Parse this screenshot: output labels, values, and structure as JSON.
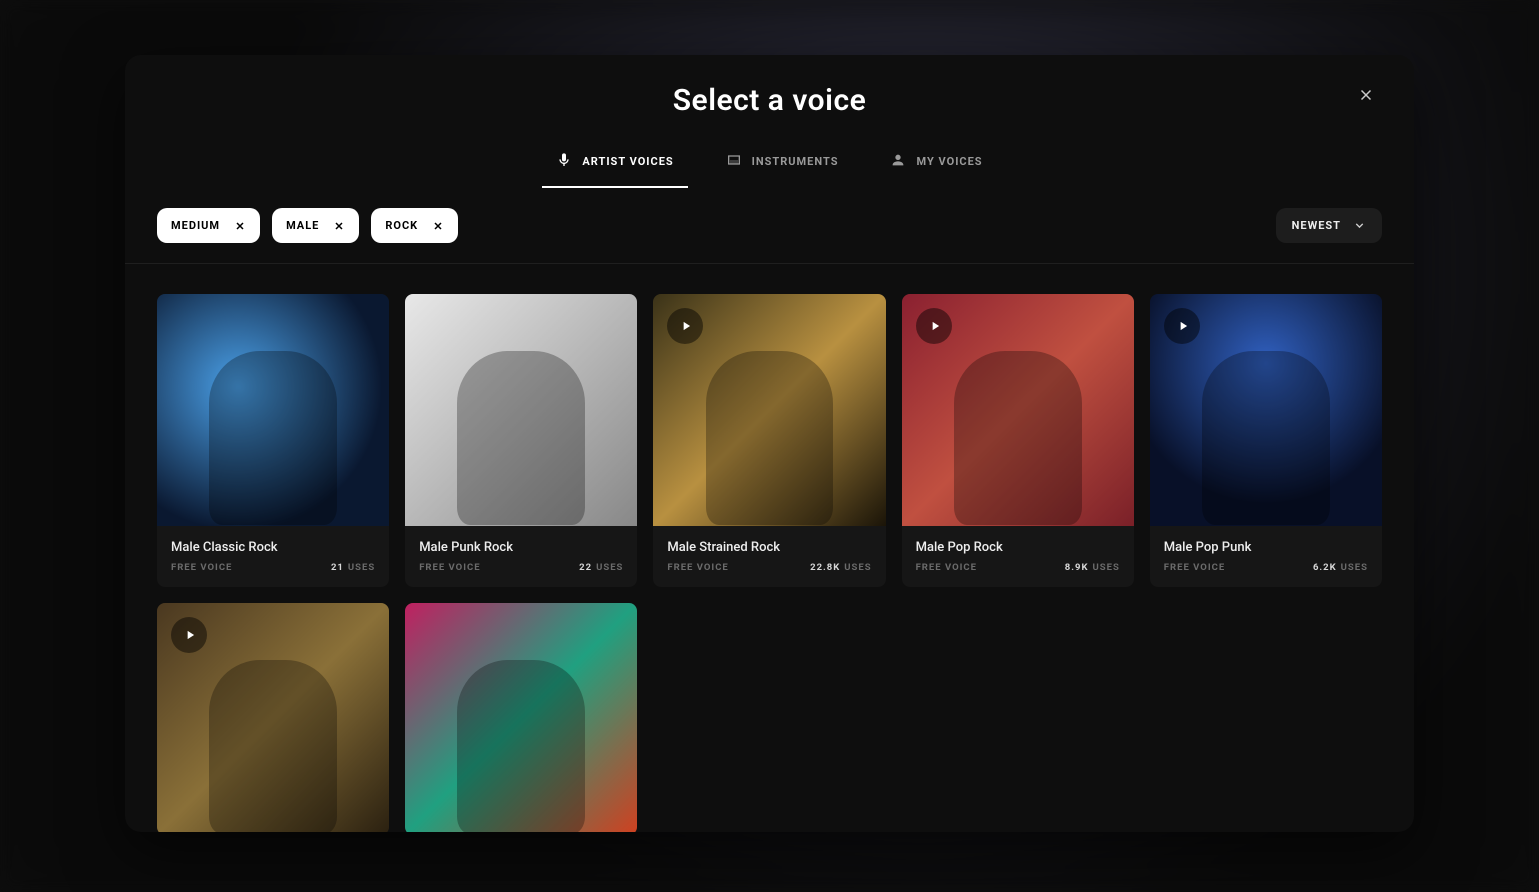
{
  "modal": {
    "title": "Select a voice",
    "sort_label": "NEWEST"
  },
  "tabs": [
    {
      "label": "ARTIST VOICES",
      "icon": "mic-icon",
      "active": true
    },
    {
      "label": "INSTRUMENTS",
      "icon": "piano-icon",
      "active": false
    },
    {
      "label": "MY VOICES",
      "icon": "person-icon",
      "active": false
    }
  ],
  "filters": [
    {
      "label": "MEDIUM"
    },
    {
      "label": "MALE"
    },
    {
      "label": "ROCK"
    }
  ],
  "uses_label": "USES",
  "free_label": "FREE VOICE",
  "cards": [
    {
      "name": "Male Classic Rock",
      "count": "21",
      "play": false,
      "bg": "bg0"
    },
    {
      "name": "Male Punk Rock",
      "count": "22",
      "play": false,
      "bg": "bg1"
    },
    {
      "name": "Male Strained Rock",
      "count": "22.8K",
      "play": true,
      "bg": "bg2"
    },
    {
      "name": "Male Pop Rock",
      "count": "8.9K",
      "play": true,
      "bg": "bg3"
    },
    {
      "name": "Male Pop Punk",
      "count": "6.2K",
      "play": true,
      "bg": "bg4"
    },
    {
      "name": "",
      "count": "",
      "play": true,
      "bg": "bg5",
      "partial": true
    },
    {
      "name": "",
      "count": "",
      "play": false,
      "bg": "bg6",
      "partial": true
    }
  ]
}
